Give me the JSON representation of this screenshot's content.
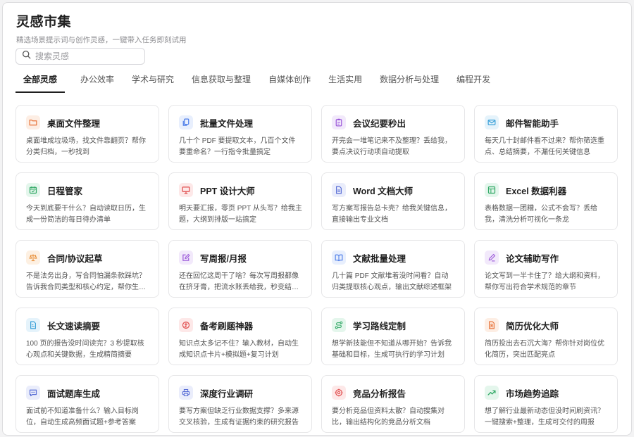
{
  "header": {
    "title": "灵感市集",
    "subtitle": "精选场景提示词与创作灵感，一键带入任务即刻试用"
  },
  "search": {
    "placeholder": "搜索灵感",
    "value": ""
  },
  "tabs": [
    {
      "label": "全部灵感",
      "active": true
    },
    {
      "label": "办公效率",
      "active": false
    },
    {
      "label": "学术与研究",
      "active": false
    },
    {
      "label": "信息获取与整理",
      "active": false
    },
    {
      "label": "自媒体创作",
      "active": false
    },
    {
      "label": "生活实用",
      "active": false
    },
    {
      "label": "数据分析与处理",
      "active": false
    },
    {
      "label": "编程开发",
      "active": false
    }
  ],
  "cards": [
    {
      "title": "桌面文件整理",
      "desc": "桌面堆成垃圾场，找文件靠翻页？帮你分类归档，一秒找到",
      "icon": "folder-icon",
      "icon_color": "#e8743b",
      "icon_bg": "#fdeee4"
    },
    {
      "title": "批量文件处理",
      "desc": "几十个 PDF 要提取文本，几百个文件要重命名？一行指令批量搞定",
      "icon": "files-icon",
      "icon_color": "#4a7be8",
      "icon_bg": "#e8effd"
    },
    {
      "title": "会议纪要秒出",
      "desc": "开完会一堆笔记来不及整理？丢给我，要点决议行动项自动提取",
      "icon": "clipboard-icon",
      "icon_color": "#9b59d9",
      "icon_bg": "#f2e9fb"
    },
    {
      "title": "邮件智能助手",
      "desc": "每天几十封邮件看不过来？帮你筛选重点、总结摘要，不漏任何关键信息",
      "icon": "mail-icon",
      "icon_color": "#3aa0d8",
      "icon_bg": "#e5f3fb"
    },
    {
      "title": "日程管家",
      "desc": "今天到底要干什么？自动读取日历，生成一份简洁的每日待办清单",
      "icon": "calendar-icon",
      "icon_color": "#2fa864",
      "icon_bg": "#e4f6ec"
    },
    {
      "title": "PPT 设计大师",
      "desc": "明天要汇报，零页 PPT 从头写？给我主题，大纲到排版一站搞定",
      "icon": "presentation-icon",
      "icon_color": "#e04a4a",
      "icon_bg": "#fde8e8"
    },
    {
      "title": "Word 文档大师",
      "desc": "写方案写报告总卡壳？给我关键信息，直接输出专业文档",
      "icon": "document-icon",
      "icon_color": "#5a6fd6",
      "icon_bg": "#eaedfb"
    },
    {
      "title": "Excel 数据利器",
      "desc": "表格数据一团糟，公式不会写？丢给我，清洗分析可视化一条龙",
      "icon": "table-icon",
      "icon_color": "#2fa864",
      "icon_bg": "#e4f6ec"
    },
    {
      "title": "合同/协议起草",
      "desc": "不是法务出身，写合同怕漏条款踩坑？告诉我合同类型和核心约定，帮你生成一份结构完整的合同",
      "icon": "scale-icon",
      "icon_color": "#e8913b",
      "icon_bg": "#fdf0e2"
    },
    {
      "title": "写周报/月报",
      "desc": "还在回忆这周干了啥？每次写周报都像在挤牙膏，把流水账丢给我，秒变结构化周报",
      "icon": "edit-icon",
      "icon_color": "#9b59d9",
      "icon_bg": "#f2e9fb"
    },
    {
      "title": "文献批量处理",
      "desc": "几十篇 PDF 文献堆着没时间看？自动归类提取核心观点，输出文献综述框架",
      "icon": "book-icon",
      "icon_color": "#4a7be8",
      "icon_bg": "#e8effd"
    },
    {
      "title": "论文辅助写作",
      "desc": "论文写到一半卡住了？给大纲和资料，帮你写出符合学术规范的章节",
      "icon": "pen-icon",
      "icon_color": "#9b59d9",
      "icon_bg": "#f2e9fb"
    },
    {
      "title": "长文速读摘要",
      "desc": "100 页的报告没时间读完？3 秒提取核心观点和关键数据，生成精简摘要",
      "icon": "file-text-icon",
      "icon_color": "#3aa0d8",
      "icon_bg": "#e5f3fb"
    },
    {
      "title": "备考刷题神器",
      "desc": "知识点太多记不住？输入教材，自动生成知识点卡片+模拟题+复习计划",
      "icon": "brain-icon",
      "icon_color": "#e04a4a",
      "icon_bg": "#fde8e8"
    },
    {
      "title": "学习路线定制",
      "desc": "想学新技能但不知道从哪开始？告诉我基础和目标，生成可执行的学习计划",
      "icon": "route-icon",
      "icon_color": "#2fa864",
      "icon_bg": "#e4f6ec"
    },
    {
      "title": "简历优化大师",
      "desc": "简历投出去石沉大海？帮你针对岗位优化简历，突出匹配亮点",
      "icon": "resume-icon",
      "icon_color": "#e8743b",
      "icon_bg": "#fdeee4"
    },
    {
      "title": "面试题库生成",
      "desc": "面试前不知道准备什么？输入目标岗位，自动生成高频面试题+参考答案",
      "icon": "message-icon",
      "icon_color": "#5a6fd6",
      "icon_bg": "#eaedfb"
    },
    {
      "title": "深度行业调研",
      "desc": "要写方案但缺乏行业数据支撑？多来源交叉核验，生成有证据约束的研究报告",
      "icon": "printer-icon",
      "icon_color": "#5a6fd6",
      "icon_bg": "#eaedfb"
    },
    {
      "title": "竞品分析报告",
      "desc": "要分析竞品但资料太散？自动搜集对比，输出结构化的竞品分析文档",
      "icon": "target-icon",
      "icon_color": "#e04a4a",
      "icon_bg": "#fde8e8"
    },
    {
      "title": "市场趋势追踪",
      "desc": "想了解行业最新动态但没时间刷资讯？一键搜索+整理，生成可交付的周报",
      "icon": "trend-icon",
      "icon_color": "#2fa864",
      "icon_bg": "#e4f6ec"
    }
  ]
}
